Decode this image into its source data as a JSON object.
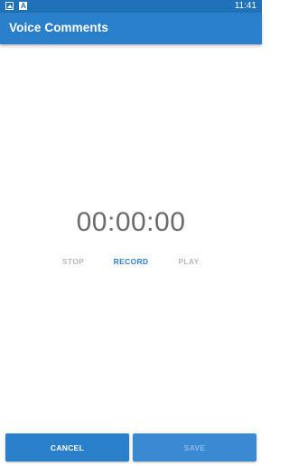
{
  "status_bar": {
    "time": "11:41",
    "icons": [
      "image-icon",
      "a-notification-icon"
    ],
    "color": "#1f71b8"
  },
  "app_bar": {
    "title": "Voice Comments",
    "color": "#2a7fcb"
  },
  "recorder": {
    "timer": "00:00:00",
    "stop_label": "STOP",
    "record_label": "RECORD",
    "play_label": "PLAY",
    "stop_enabled": false,
    "record_enabled": true,
    "play_enabled": false
  },
  "footer": {
    "cancel_label": "CANCEL",
    "save_label": "SAVE",
    "save_enabled": false
  }
}
